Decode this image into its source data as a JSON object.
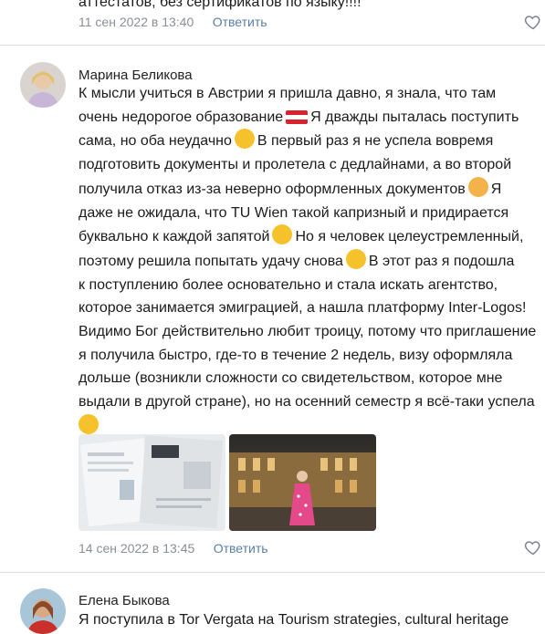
{
  "top_comment": {
    "text_tail": "аттестатов, без сертификатов по языку!!!!",
    "date": "11 сен 2022 в 13:40",
    "reply_label": "Ответить"
  },
  "comment1": {
    "author": "Марина Беликова",
    "lines": [
      "К мысли учиться в Австрии я пришла давно, я знала, что там",
      "очень недорогое образование",
      "Я дважды пыталась поступить",
      "сама, но оба неудачно",
      "В первый раз я не успела вовремя",
      "подготовить документы и пролетела с дедлайнами, а во второй",
      "получила отказ из-за неверно оформленных документов",
      "Я",
      "даже не ожидала, что TU Wien такой капризный и придирается",
      "буквально к каждой запятой",
      "Но я человек целеустремленный,",
      "поэтому решила попытать удачу снова",
      "В этот раз я подошла",
      "к поступлению более основательно и стала искать агентство,",
      "которое занимается эмиграцией, а нашла платформу Inter-Logos!",
      "Видимо Бог действительно любит троицу, потому что приглашение",
      "я получила быстро, где-то в течение 2 недель, визу оформляла",
      "дольше (возникли сложности со свидетельством, которое мне",
      "выдали в другой стране), но на осенний семестр я всё-таки успела"
    ],
    "date": "14 сен 2022 в 13:45",
    "reply_label": "Ответить",
    "photos": [
      "document-photo",
      "vienna-street-photo"
    ]
  },
  "comment2": {
    "author": "Елена Быкова",
    "text": "Я поступила в Tor Vergata на Tourism strategies, cultural heritage"
  },
  "colors": {
    "meta": "#8a8f96",
    "reply": "#5b7fa6",
    "divider": "#dcdcdc",
    "emoji": "#f6c22c"
  }
}
